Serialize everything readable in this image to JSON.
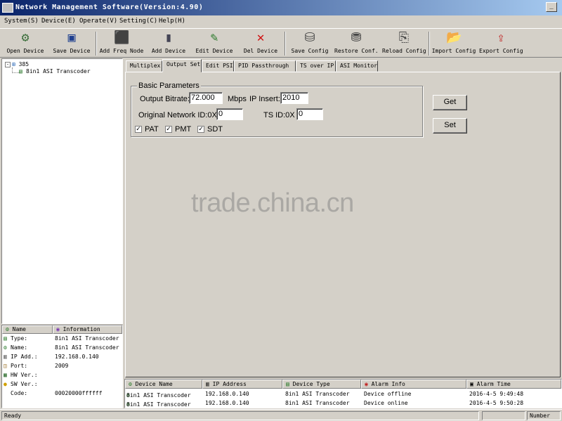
{
  "window": {
    "title": "Network Management Software(Version:4.90)",
    "min_glyph": "_"
  },
  "menu": [
    "System(S)",
    "Device(E)",
    "Operate(V)",
    "Setting(C)",
    "Help(H)"
  ],
  "toolbar": [
    {
      "label": "Open Device",
      "icon": "open-device-icon",
      "glyph": "⚙"
    },
    {
      "label": "Save Device",
      "icon": "save-device-icon",
      "glyph": "▣"
    },
    {
      "label": "Add Freq Node",
      "icon": "add-freq-node-icon",
      "glyph": "⬛"
    },
    {
      "label": "Add Device",
      "icon": "add-device-icon",
      "glyph": "▮"
    },
    {
      "label": "Edit Device",
      "icon": "edit-device-icon",
      "glyph": "✎"
    },
    {
      "label": "Del Device",
      "icon": "delete-device-icon",
      "glyph": "✕"
    },
    {
      "label": "Save Config",
      "icon": "save-config-icon",
      "glyph": "⛁"
    },
    {
      "label": "Restore Conf.",
      "icon": "restore-config-icon",
      "glyph": "⛃"
    },
    {
      "label": "Reload Config",
      "icon": "reload-config-icon",
      "glyph": "⎘"
    },
    {
      "label": "Import Config",
      "icon": "import-config-icon",
      "glyph": "📂"
    },
    {
      "label": "Export Config",
      "icon": "export-config-icon",
      "glyph": "⇪"
    }
  ],
  "tree": {
    "expander": "-",
    "root_label": "385",
    "child_label": "8in1 ASI Transcoder"
  },
  "info": {
    "headers": [
      "Name",
      "Information"
    ],
    "rows": [
      {
        "key": "Type:",
        "value": "8in1 ASI Transcoder"
      },
      {
        "key": "Name:",
        "value": "8in1 ASI Transcoder"
      },
      {
        "key": "IP Add.:",
        "value": "192.168.0.140"
      },
      {
        "key": "Port:",
        "value": "2009"
      },
      {
        "key": "HW Ver.:",
        "value": ""
      },
      {
        "key": "SW Ver.:",
        "value": ""
      },
      {
        "key": "Code:",
        "value": "00020000ffffff"
      }
    ]
  },
  "tabs": [
    "Multiplex",
    "Output Set",
    "Edit PSI",
    "PID Passthrough",
    "TS over IP",
    "ASI Monitor"
  ],
  "active_tab": 1,
  "basic_params": {
    "group_title": "Basic Parameters",
    "output_bitrate_label": "Output Bitrate:",
    "output_bitrate_value": "72.000",
    "bitrate_unit": "Mbps",
    "ip_insert_label": "IP Insert:",
    "ip_insert_value": "2010",
    "onid_label": "Original Network ID:0X",
    "onid_value": "0",
    "tsid_label": "TS ID:0X",
    "tsid_value": "0",
    "check_mark": "✓",
    "checks": [
      {
        "label": "PAT",
        "checked": true
      },
      {
        "label": "PMT",
        "checked": true
      },
      {
        "label": "SDT",
        "checked": true
      }
    ]
  },
  "buttons": {
    "get": "Get",
    "set": "Set"
  },
  "alarm": {
    "headers": [
      "Device Name",
      "IP Address",
      "Device Type",
      "Alarm Info",
      "Alarm Time"
    ],
    "rows": [
      [
        "8in1 ASI Transcoder",
        "192.168.0.140",
        "8in1 ASI Transcoder",
        "Device offline",
        "2016-4-5 9:49:48"
      ],
      [
        "8in1 ASI Transcoder",
        "192.168.0.140",
        "8in1 ASI Transcoder",
        "Device online",
        "2016-4-5 9:50:28"
      ]
    ]
  },
  "status": {
    "left": "Ready",
    "right": "Number"
  },
  "watermark": "trade.china.cn"
}
